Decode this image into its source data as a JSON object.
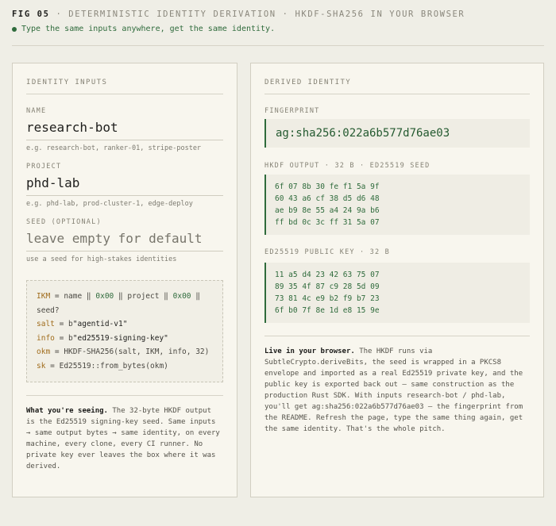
{
  "header": {
    "fig": "FIG 05",
    "sep": "·",
    "title": "DETERMINISTIC IDENTITY DERIVATION · HKDF-SHA256 IN YOUR BROWSER",
    "tagline": "Type the same inputs anywhere, get the same identity."
  },
  "inputs": {
    "title": "IDENTITY INPUTS",
    "name": {
      "label": "NAME",
      "value": "research-bot",
      "hint": "e.g. research-bot, ranker-01, stripe-poster"
    },
    "project": {
      "label": "PROJECT",
      "value": "phd-lab",
      "hint": "e.g. phd-lab, prod-cluster-1, edge-deploy"
    },
    "seed": {
      "label": "SEED (OPTIONAL)",
      "placeholder": "leave empty for default",
      "hint": "use a seed for high-stakes identities"
    }
  },
  "code": {
    "l1_kw": "IKM",
    "l1_a": " = name ‖ ",
    "l1_hex1": "0x00",
    "l1_b": " ‖ project ‖ ",
    "l1_hex2": "0x00",
    "l1_c": " ‖",
    "l2": "seed?",
    "l3_kw": "salt",
    "l3_a": " = b",
    "l3_str": "\"agentid-v1\"",
    "l4_kw": "info",
    "l4_a": " = b",
    "l4_str": "\"ed25519-signing-key\"",
    "l5_kw": "okm",
    "l5_a": " = HKDF-SHA256(salt, IKM, info, 32)",
    "l6_kw": "sk",
    "l6_a": " = Ed25519::from_bytes(okm)"
  },
  "left_explain": {
    "lead": "What you're seeing.",
    "body": " The 32-byte HKDF output is the Ed25519 signing-key seed. Same inputs → same output bytes → same identity, on every machine, every clone, every CI runner. No private key ever leaves the box where it was derived."
  },
  "derived": {
    "title": "DERIVED IDENTITY",
    "fingerprint_label": "FINGERPRINT",
    "fingerprint": "ag:sha256:022a6b577d76ae03",
    "hkdf_label": "HKDF OUTPUT · 32 B · ED25519 SEED",
    "hkdf_lines": [
      "6f 07 8b 30 fe f1 5a 9f",
      "60 43 a6 cf 38 d5 d6 48",
      "ae b9 8e 55 a4 24 9a b6",
      "ff bd 0c 3c ff 31 5a 07"
    ],
    "pub_label": "ED25519 PUBLIC KEY · 32 B",
    "pub_lines": [
      "11 a5 d4 23 42 63 75 07",
      "89 35 4f 87 c9 28 5d 09",
      "73 81 4c e9 b2 f9 b7 23",
      "6f b0 7f 8e 1d e8 15 9e"
    ]
  },
  "right_explain": {
    "lead": "Live in your browser.",
    "p1": " The HKDF runs via ",
    "api": "SubtleCrypto.deriveBits",
    "p2": ", the seed is wrapped in a PKCS8 envelope and imported as a real Ed25519 private key, and the public key is exported back out — same construction as the production Rust SDK. With inputs ",
    "inputs": "research-bot / phd-lab",
    "p3": ", you'll get ",
    "fp": "ag:sha256:022a6b577d76ae03",
    "p4": " — the fingerprint from the README. Refresh the page, type the same thing again, get the same identity. That's the whole pitch."
  }
}
